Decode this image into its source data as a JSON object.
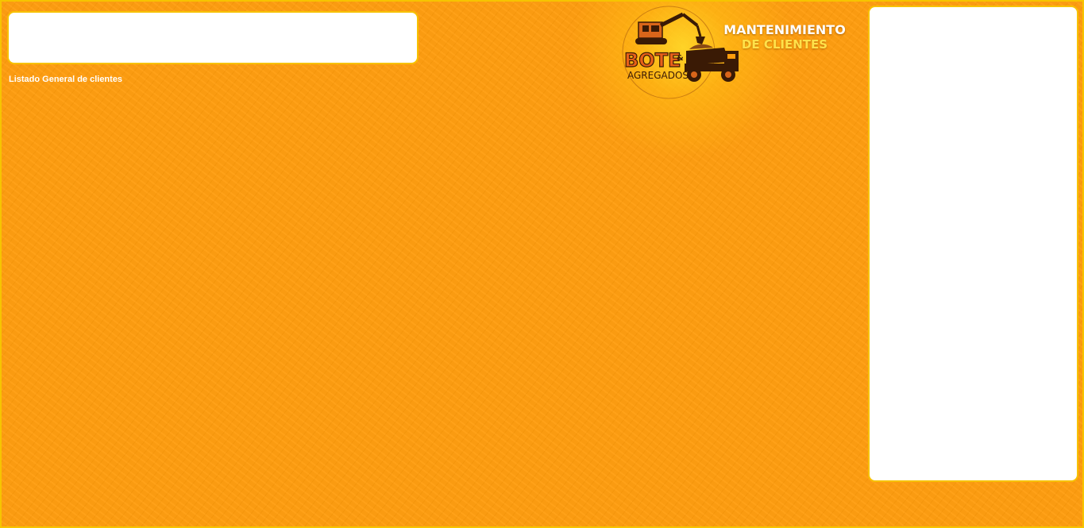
{
  "header": {
    "title_line1": "MANTENIMIENTO",
    "title_line2": "DE CLIENTES"
  },
  "logo": {
    "brand_main": "BOTE",
    "brand_amp": "&",
    "brand_sub": "AGREGADOS",
    "icons": [
      "excavator-icon",
      "dump-truck-icon"
    ]
  },
  "main": {
    "list_title": "Listado General de clientes"
  },
  "colors": {
    "background": "#ff9c0c",
    "border": "#f7c100",
    "panel": "#ffffff",
    "title_primary": "#ffffff",
    "title_secondary": "#ffe14a"
  }
}
